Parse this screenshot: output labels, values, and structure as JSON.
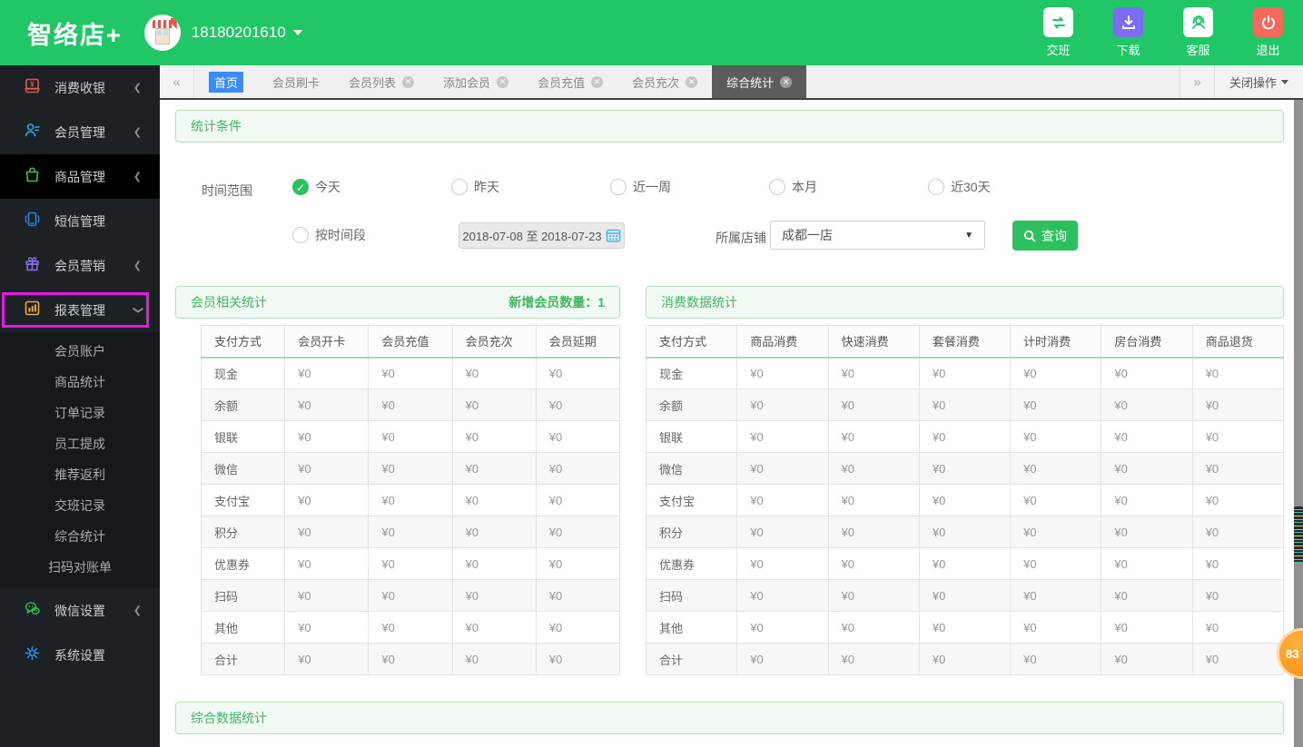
{
  "header": {
    "logo": "智络店+",
    "user_phone": "18180201610",
    "actions": [
      {
        "label": "交班",
        "icon": "swap"
      },
      {
        "label": "下载",
        "icon": "download"
      },
      {
        "label": "客服",
        "icon": "headset"
      },
      {
        "label": "退出",
        "icon": "power"
      }
    ]
  },
  "sidebar": {
    "items": [
      {
        "label": "消费收银",
        "icon": "cash-register",
        "chevron": "left"
      },
      {
        "label": "会员管理",
        "icon": "member",
        "chevron": "left"
      },
      {
        "label": "商品管理",
        "icon": "goods",
        "chevron": "left",
        "active": true
      },
      {
        "label": "短信管理",
        "icon": "sms",
        "chevron": ""
      },
      {
        "label": "会员营销",
        "icon": "gift",
        "chevron": "left"
      },
      {
        "label": "报表管理",
        "icon": "chart",
        "chevron": "down",
        "annotated": true
      }
    ],
    "report_submenu": [
      "会员账户",
      "商品统计",
      "订单记录",
      "员工提成",
      "推荐返利",
      "交班记录",
      "综合统计",
      "扫码对账单"
    ],
    "bottom_items": [
      {
        "label": "微信设置",
        "icon": "wechat",
        "chevron": "left"
      },
      {
        "label": "系统设置",
        "icon": "gear",
        "chevron": ""
      }
    ]
  },
  "tabbar": {
    "scroll_left": "«",
    "scroll_right": "»",
    "tabs": [
      {
        "label": "首页",
        "closable": false,
        "home": true
      },
      {
        "label": "会员刷卡",
        "closable": false
      },
      {
        "label": "会员列表",
        "closable": true
      },
      {
        "label": "添加会员",
        "closable": true
      },
      {
        "label": "会员充值",
        "closable": true
      },
      {
        "label": "会员充次",
        "closable": true
      },
      {
        "label": "综合统计",
        "closable": true,
        "active": true
      }
    ],
    "close_menu": "关闭操作"
  },
  "filters": {
    "panel_title": "统计条件",
    "time_label": "时间范围",
    "options": [
      "今天",
      "昨天",
      "近一周",
      "本月",
      "近30天"
    ],
    "selected": "今天",
    "range_option": "按时间段",
    "date_range": "2018-07-08 至 2018-07-23",
    "store_label": "所属店铺",
    "store_value": "成都一店",
    "search_label": "查询"
  },
  "member_stats": {
    "title": "会员相关统计",
    "badge": "新增会员数量：1",
    "columns": [
      "支付方式",
      "会员开卡",
      "会员充值",
      "会员充次",
      "会员延期"
    ],
    "rows": [
      {
        "label": "现金",
        "values": [
          "¥0",
          "¥0",
          "¥0",
          "¥0"
        ]
      },
      {
        "label": "余额",
        "values": [
          "¥0",
          "¥0",
          "¥0",
          "¥0"
        ]
      },
      {
        "label": "银联",
        "values": [
          "¥0",
          "¥0",
          "¥0",
          "¥0"
        ]
      },
      {
        "label": "微信",
        "values": [
          "¥0",
          "¥0",
          "¥0",
          "¥0"
        ]
      },
      {
        "label": "支付宝",
        "values": [
          "¥0",
          "¥0",
          "¥0",
          "¥0"
        ]
      },
      {
        "label": "积分",
        "values": [
          "¥0",
          "¥0",
          "¥0",
          "¥0"
        ]
      },
      {
        "label": "优惠券",
        "values": [
          "¥0",
          "¥0",
          "¥0",
          "¥0"
        ]
      },
      {
        "label": "扫码",
        "values": [
          "¥0",
          "¥0",
          "¥0",
          "¥0"
        ]
      },
      {
        "label": "其他",
        "values": [
          "¥0",
          "¥0",
          "¥0",
          "¥0"
        ]
      },
      {
        "label": "合计",
        "values": [
          "¥0",
          "¥0",
          "¥0",
          "¥0"
        ]
      }
    ]
  },
  "consume_stats": {
    "title": "消费数据统计",
    "columns": [
      "支付方式",
      "商品消费",
      "快速消费",
      "套餐消费",
      "计时消费",
      "房台消费",
      "商品退货"
    ],
    "rows": [
      {
        "label": "现金",
        "values": [
          "¥0",
          "¥0",
          "¥0",
          "¥0",
          "¥0",
          "¥0"
        ]
      },
      {
        "label": "余额",
        "values": [
          "¥0",
          "¥0",
          "¥0",
          "¥0",
          "¥0",
          "¥0"
        ]
      },
      {
        "label": "银联",
        "values": [
          "¥0",
          "¥0",
          "¥0",
          "¥0",
          "¥0",
          "¥0"
        ]
      },
      {
        "label": "微信",
        "values": [
          "¥0",
          "¥0",
          "¥0",
          "¥0",
          "¥0",
          "¥0"
        ]
      },
      {
        "label": "支付宝",
        "values": [
          "¥0",
          "¥0",
          "¥0",
          "¥0",
          "¥0",
          "¥0"
        ]
      },
      {
        "label": "积分",
        "values": [
          "¥0",
          "¥0",
          "¥0",
          "¥0",
          "¥0",
          "¥0"
        ]
      },
      {
        "label": "优惠券",
        "values": [
          "¥0",
          "¥0",
          "¥0",
          "¥0",
          "¥0",
          "¥0"
        ]
      },
      {
        "label": "扫码",
        "values": [
          "¥0",
          "¥0",
          "¥0",
          "¥0",
          "¥0",
          "¥0"
        ]
      },
      {
        "label": "其他",
        "values": [
          "¥0",
          "¥0",
          "¥0",
          "¥0",
          "¥0",
          "¥0"
        ]
      },
      {
        "label": "合计",
        "values": [
          "¥0",
          "¥0",
          "¥0",
          "¥0",
          "¥0",
          "¥0"
        ]
      }
    ]
  },
  "summary_panel": {
    "title": "综合数据统计"
  },
  "float_badge": "83",
  "colors": {
    "brand_green": "#21c766",
    "sidebar_bg": "#1d2126",
    "annotation_magenta": "#e318e3",
    "panel_green_bg": "#f1faf2",
    "panel_green_border": "#b5e0bd",
    "panel_green_text": "#3fb761",
    "active_tab_bg": "#5c5c5c",
    "home_tab_bg": "#3a8bfd",
    "button_green": "#2ec05c",
    "badge_orange": "#f78a12"
  }
}
